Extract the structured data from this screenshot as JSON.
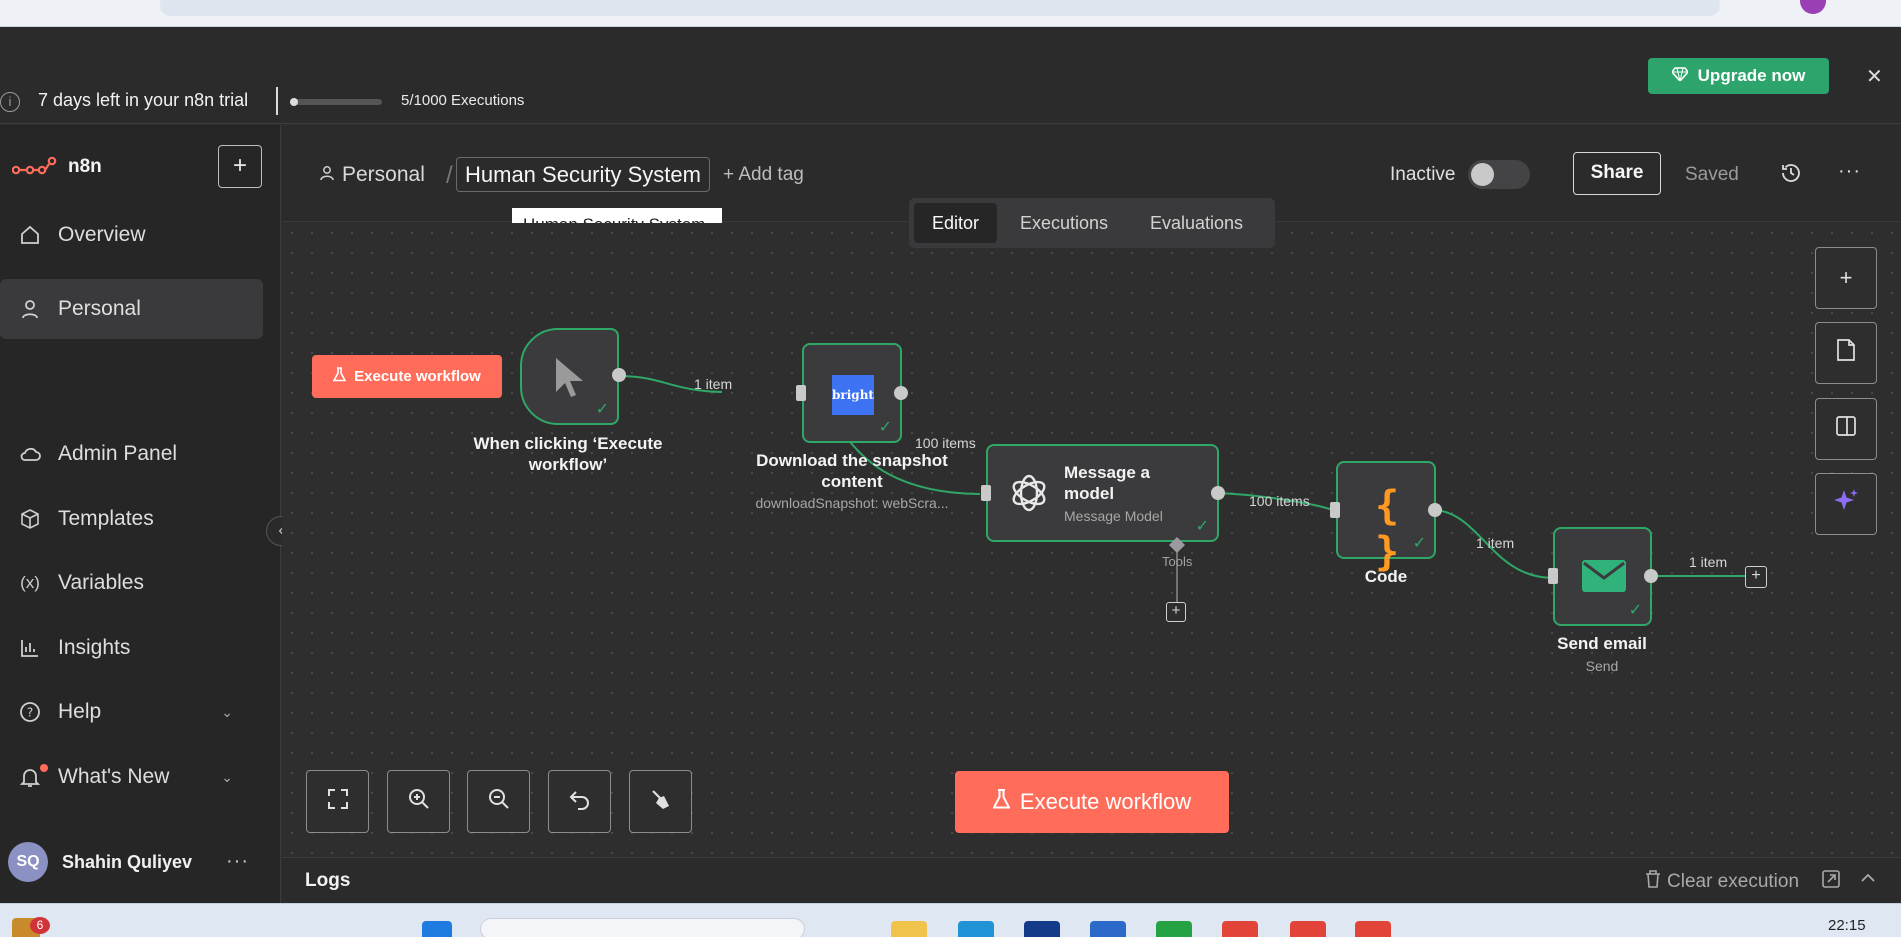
{
  "trial": {
    "message": "7 days left in your n8n trial",
    "executions": "5/1000 Executions",
    "executions_progress": 0.005,
    "upgrade_label": "Upgrade now"
  },
  "brand": {
    "name": "n8n",
    "accent": "#ff6d5a",
    "success": "#2fa766"
  },
  "sidebar": {
    "items": [
      {
        "label": "Overview",
        "icon": "home-icon"
      },
      {
        "label": "Personal",
        "icon": "user-icon",
        "active": true
      },
      {
        "label": "Admin Panel",
        "icon": "cloud-icon"
      },
      {
        "label": "Templates",
        "icon": "box-icon"
      },
      {
        "label": "Variables",
        "icon": "variables-icon"
      },
      {
        "label": "Insights",
        "icon": "chart-icon"
      },
      {
        "label": "Help",
        "icon": "help-icon"
      },
      {
        "label": "What's New",
        "icon": "bell-icon"
      }
    ],
    "user": {
      "initials": "SQ",
      "name": "Shahin Quliyev"
    }
  },
  "header": {
    "project": "Personal",
    "workflow_name": "Human Security System",
    "add_tag": "+ Add tag",
    "tooltip": "Human Security System",
    "status": "Inactive",
    "share": "Share",
    "saved": "Saved"
  },
  "tabs": [
    "Editor",
    "Executions",
    "Evaluations"
  ],
  "canvas": {
    "execute_small": "Execute workflow",
    "execute_big": "Execute workflow",
    "nodes": {
      "trigger": {
        "label": "When clicking ‘Execute workflow’"
      },
      "download": {
        "label": "Download the snapshot content",
        "sub": "downloadSnapshot: webScra...",
        "logo_text": "bright"
      },
      "openai": {
        "title": "Message a model",
        "sub": "Message Model",
        "tools": "Tools"
      },
      "code": {
        "label": "Code",
        "glyph": "{ }"
      },
      "email": {
        "label": "Send email",
        "sub": "Send"
      }
    },
    "connections": [
      "1 item",
      "100 items",
      "100 items",
      "1 item",
      "1 item"
    ]
  },
  "logs": {
    "title": "Logs",
    "clear": "Clear execution"
  },
  "taskbar": {
    "time": "22:15",
    "notif_count": "6"
  }
}
